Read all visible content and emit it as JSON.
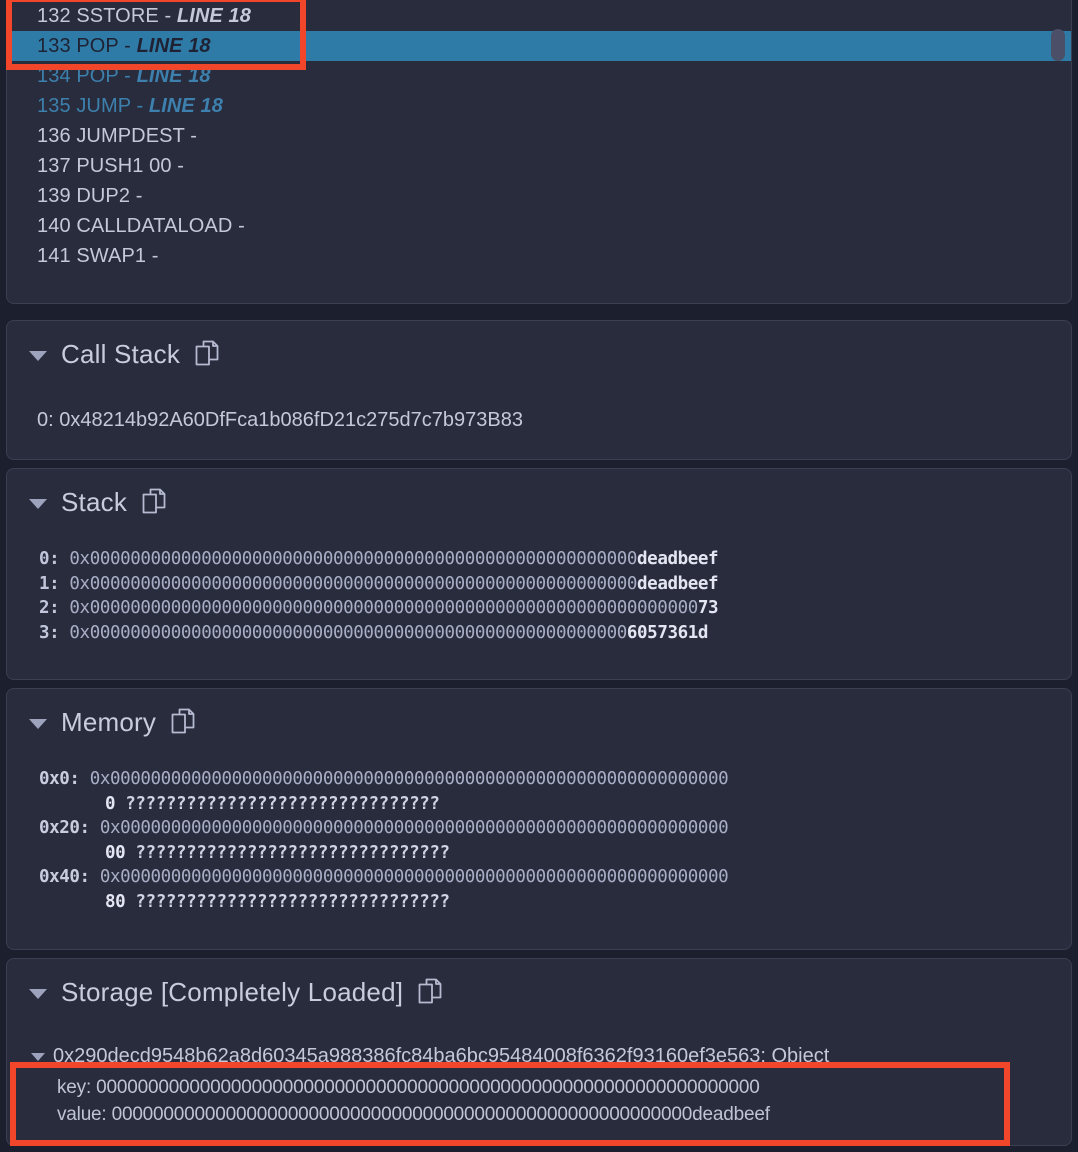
{
  "theme": {
    "page_bg": "#1b1f2e",
    "panel_bg": "#282c3d",
    "panel_border": "#3a3f52",
    "text": "#c5c8d8",
    "accent_blue": "#3d80ad",
    "highlight_bg": "#2f7ba7",
    "annotation_red": "#f2462a"
  },
  "opcodes": {
    "rows": [
      {
        "index": "132",
        "op": "SSTORE",
        "sep": "-",
        "line": "LINE 18",
        "state": "past"
      },
      {
        "index": "133",
        "op": "POP",
        "sep": "-",
        "line": "LINE 18",
        "state": "current"
      },
      {
        "index": "134",
        "op": "POP",
        "sep": "-",
        "line": "LINE 18",
        "state": "future"
      },
      {
        "index": "135",
        "op": "JUMP",
        "sep": "-",
        "line": "LINE 18",
        "state": "future"
      },
      {
        "index": "136",
        "op": "JUMPDEST",
        "sep": "-",
        "line": "",
        "state": "past"
      },
      {
        "index": "137",
        "op": "PUSH1 00",
        "sep": "-",
        "line": "",
        "state": "past"
      },
      {
        "index": "139",
        "op": "DUP2",
        "sep": "-",
        "line": "",
        "state": "past"
      },
      {
        "index": "140",
        "op": "CALLDATALOAD",
        "sep": "-",
        "line": "",
        "state": "past"
      },
      {
        "index": "141",
        "op": "SWAP1",
        "sep": "-",
        "line": "",
        "state": "past"
      }
    ]
  },
  "call_stack": {
    "title": "Call Stack",
    "copy_icon": "copy-icon",
    "caret_icon": "caret-down-icon",
    "entries": [
      {
        "index": "0:",
        "address": "0x48214b92A60DfFca1b086fD21c275d7c7b973B83"
      }
    ]
  },
  "stack": {
    "title": "Stack",
    "copy_icon": "copy-icon",
    "caret_icon": "caret-down-icon",
    "entries": [
      {
        "index": "0:",
        "prefix": "0x",
        "zeros": "000000000000000000000000000000000000000000000000000000",
        "tail": "deadbeef"
      },
      {
        "index": "1:",
        "prefix": "0x",
        "zeros": "000000000000000000000000000000000000000000000000000000",
        "tail": "deadbeef"
      },
      {
        "index": "2:",
        "prefix": "0x",
        "zeros": "000000000000000000000000000000000000000000000000000000000000",
        "tail": "73"
      },
      {
        "index": "3:",
        "prefix": "0x",
        "zeros": "00000000000000000000000000000000000000000000000000000",
        "tail": "6057361d"
      }
    ]
  },
  "memory": {
    "title": "Memory",
    "copy_icon": "copy-icon",
    "caret_icon": "caret-down-icon",
    "entries": [
      {
        "label": "0x0:",
        "prefix": "0x",
        "zeros": "0000000000000000000000000000000000000000000000000000000000000",
        "tail": "0",
        "ascii": "???????????????????????????????"
      },
      {
        "label": "0x20:",
        "prefix": "0x",
        "zeros": "000000000000000000000000000000000000000000000000000000000000",
        "tail": "00",
        "ascii": "???????????????????????????????"
      },
      {
        "label": "0x40:",
        "prefix": "0x",
        "zeros": "000000000000000000000000000000000000000000000000000000000000",
        "tail": "80",
        "ascii": "???????????????????????????????"
      }
    ]
  },
  "storage": {
    "title": "Storage [Completely Loaded]",
    "copy_icon": "copy-icon",
    "caret_icon": "caret-down-icon",
    "objects": [
      {
        "hash": "0x290decd9548b62a8d60345a988386fc84ba6bc95484008f6362f93160ef3e563:",
        "type": "Object",
        "key_label": "key:",
        "key_value": "0000000000000000000000000000000000000000000000000000000000000000",
        "value_label": "value:",
        "value_value": "00000000000000000000000000000000000000000000000000000000deadbeef"
      }
    ]
  },
  "annotations": [
    {
      "name": "opcode-highlight-box"
    },
    {
      "name": "storage-keyvalue-box"
    }
  ]
}
